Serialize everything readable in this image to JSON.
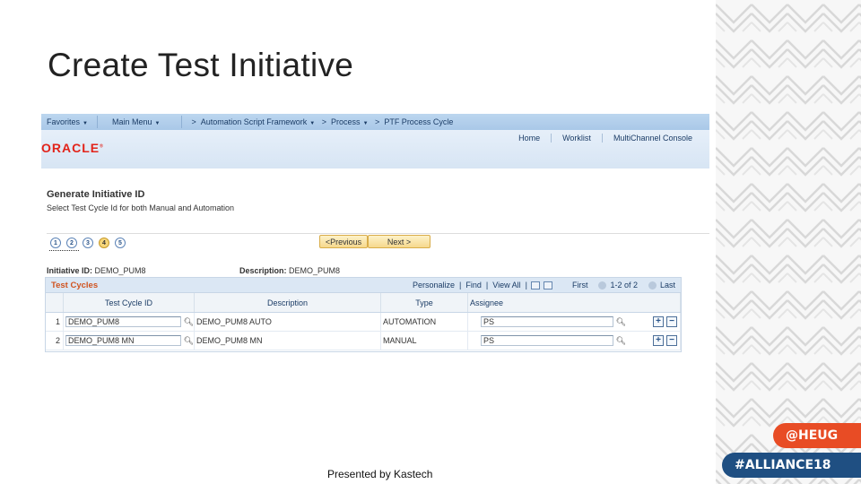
{
  "slide": {
    "title": "Create Test Initiative",
    "footer": "Presented by Kastech",
    "tags": {
      "heug": "@HEUG",
      "alliance": "#ALLIANCE18"
    }
  },
  "ps": {
    "nav": {
      "favorites": "Favorites",
      "main_menu": "Main Menu",
      "crumbs": [
        "Automation Script Framework",
        "Process",
        "PTF Process Cycle"
      ],
      "crumb_sep": ">"
    },
    "header_links": [
      "Home",
      "Worklist",
      "MultiChannel Console"
    ],
    "logo": "ORACLE",
    "page_title": "Generate Initiative ID",
    "page_subtitle": "Select Test Cycle Id for both Manual and Automation",
    "steps": [
      "1",
      "2",
      "3",
      "4",
      "5"
    ],
    "current_step": 4,
    "buttons": {
      "previous": "<Previous",
      "next": "Next >"
    },
    "initiative_label": "Initiative ID:",
    "initiative_value": "DEMO_PUM8",
    "description_label": "Description:",
    "description_value": "DEMO_PUM8",
    "grid": {
      "title": "Test Cycles",
      "tools": {
        "personalize": "Personalize",
        "find": "Find",
        "view_all": "View All"
      },
      "pager": {
        "first": "First",
        "range": "1-2 of 2",
        "last": "Last"
      },
      "columns": [
        "Test Cycle ID",
        "Description",
        "Type",
        "Assignee"
      ],
      "rows": [
        {
          "num": "1",
          "id": "DEMO_PUM8",
          "desc": "DEMO_PUM8 AUTO",
          "type": "AUTOMATION",
          "assignee": "PS"
        },
        {
          "num": "2",
          "id": "DEMO_PUM8 MN",
          "desc": "DEMO_PUM8 MN",
          "type": "MANUAL",
          "assignee": "PS"
        }
      ]
    }
  }
}
